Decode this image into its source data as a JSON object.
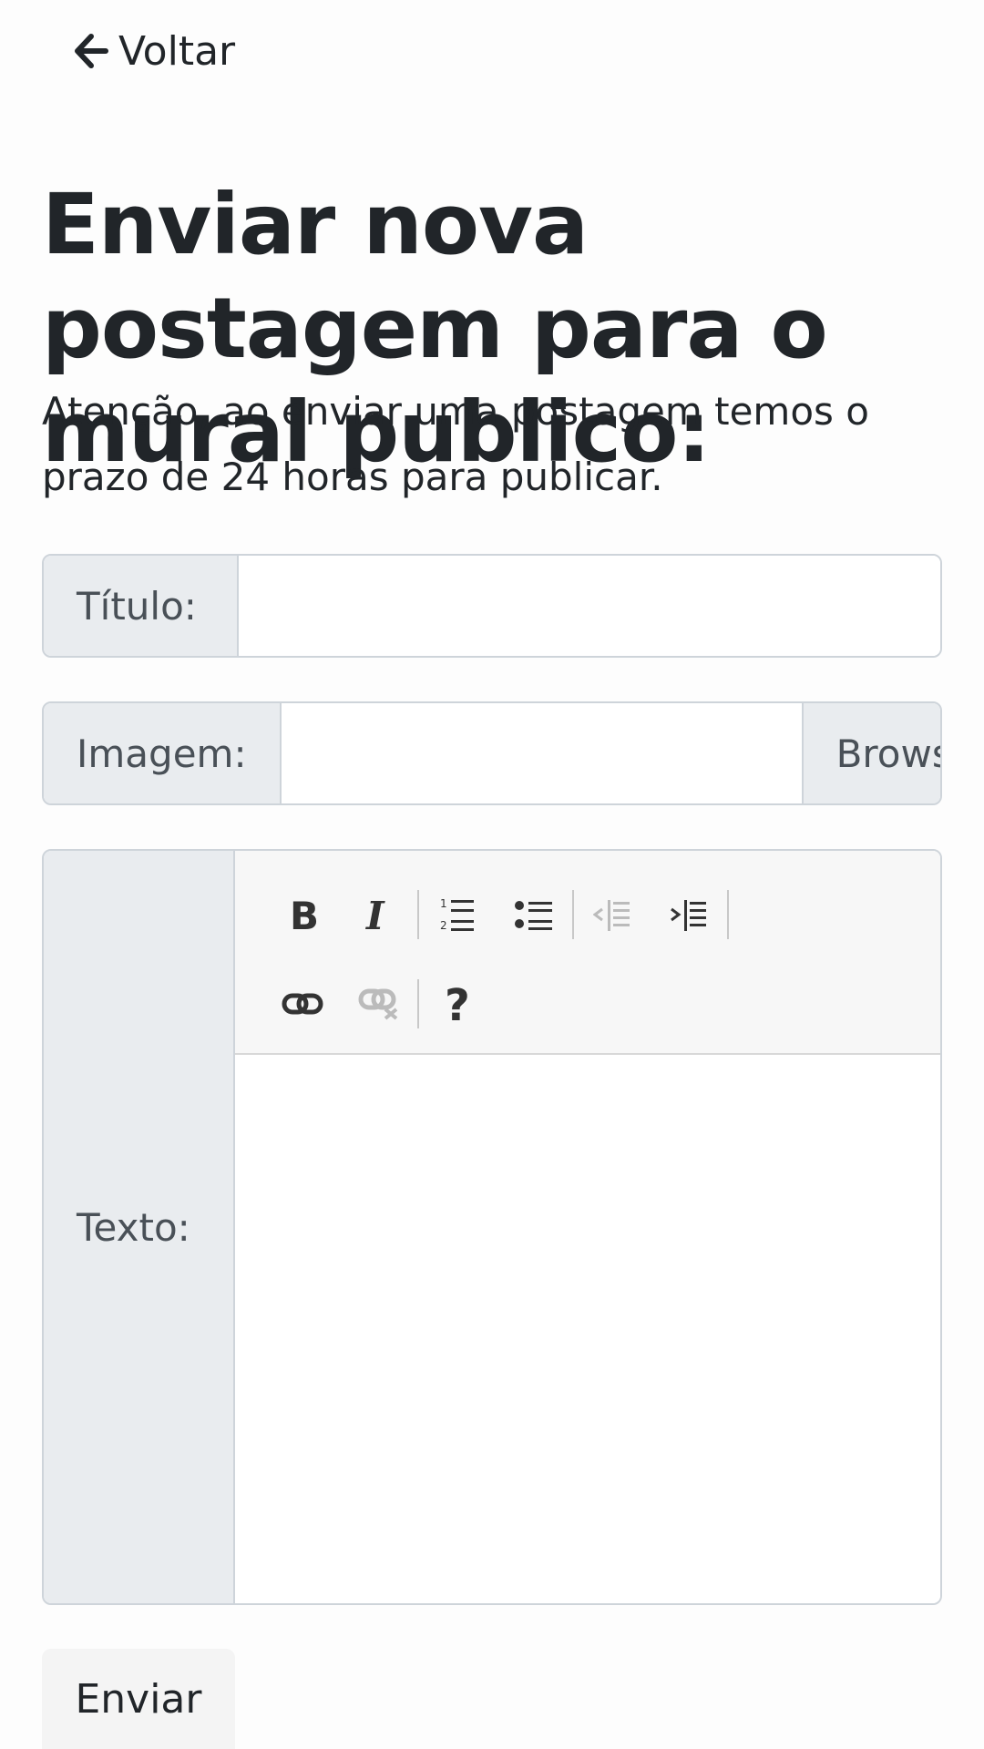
{
  "nav": {
    "back_label": "Voltar",
    "back_icon": "arrow-left-icon"
  },
  "header": {
    "title": "Enviar nova postagem para o mural publico:",
    "notice": "Atenção, ao enviar uma postagem temos o prazo de 24 horas para publicar."
  },
  "form": {
    "title_label": "Título:",
    "title_value": "",
    "image_label": "Imagem:",
    "image_value": "",
    "browse_label": "Browse",
    "text_label": "Texto:",
    "text_value": "",
    "submit_label": "Enviar"
  },
  "toolbar": {
    "row1": [
      "bold-icon",
      "italic-icon",
      "ordered-list-icon",
      "unordered-list-icon",
      "outdent-icon",
      "indent-icon"
    ],
    "row2": [
      "link-icon",
      "unlink-icon",
      "help-icon"
    ],
    "disabled": [
      "outdent-icon",
      "unlink-icon"
    ]
  },
  "colors": {
    "text": "#212529",
    "addon_bg": "#e9ecef",
    "border": "#ced4da",
    "toolbar_bg": "#f7f7f7"
  }
}
